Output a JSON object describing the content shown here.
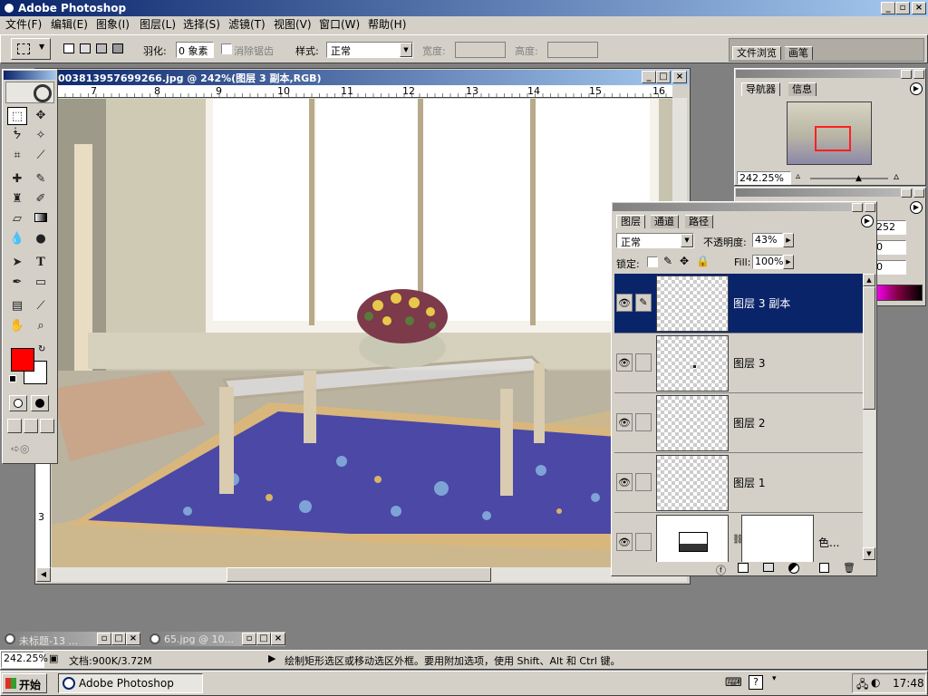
{
  "app": {
    "title": "Adobe Photoshop",
    "title_icon": "photoshop-icon"
  },
  "menu": [
    "文件(F)",
    "编辑(E)",
    "图象(I)",
    "图层(L)",
    "选择(S)",
    "滤镜(T)",
    "视图(V)",
    "窗口(W)",
    "帮助(H)"
  ],
  "options": {
    "feather_label": "羽化:",
    "feather_value": "0 象素",
    "antialias_label": "消除锯齿",
    "style_label": "样式:",
    "style_value": "正常",
    "width_label": "宽度:",
    "height_label": "高度:",
    "tabs": [
      "文件浏览",
      "画笔"
    ]
  },
  "document": {
    "title": "003813957699266.jpg @ 242%(图层 3 副本,RGB)",
    "ruler_h": [
      "7",
      "8",
      "9",
      "10",
      "11",
      "12",
      "13",
      "14",
      "15",
      "16"
    ],
    "ruler_v": [
      "3"
    ]
  },
  "navigator": {
    "tabs": [
      "导航器",
      "信息"
    ],
    "zoom": "242.25%"
  },
  "color_values": [
    "252",
    "0",
    "0"
  ],
  "layers": {
    "tabs": [
      "图层",
      "通道",
      "路径"
    ],
    "blend_mode": "正常",
    "opacity_label": "不透明度:",
    "opacity": "43%",
    "lock_label": "锁定:",
    "fill_label": "Fill:",
    "fill": "100%",
    "rows": [
      {
        "name": "图层 3 副本",
        "selected": true
      },
      {
        "name": "图层 3",
        "selected": false
      },
      {
        "name": "图层 2",
        "selected": false
      },
      {
        "name": "图层 1",
        "selected": false
      },
      {
        "name": "色...",
        "selected": false
      }
    ]
  },
  "minimized": [
    "未标题-13 ...",
    "65.jpg @ 10..."
  ],
  "status": {
    "zoom": "242.25%",
    "doc_label": "文档:900K/3.72M",
    "hint": "绘制矩形选区或移动选区外框。要用附加选项，使用 Shift、Alt 和 Ctrl 键。"
  },
  "taskbar": {
    "start": "开始",
    "task": "Adobe Photoshop",
    "clock": "17:48"
  },
  "colors": {
    "foreground": "#ff0000",
    "background": "#ffffff",
    "titlebar": "#0a246a"
  }
}
